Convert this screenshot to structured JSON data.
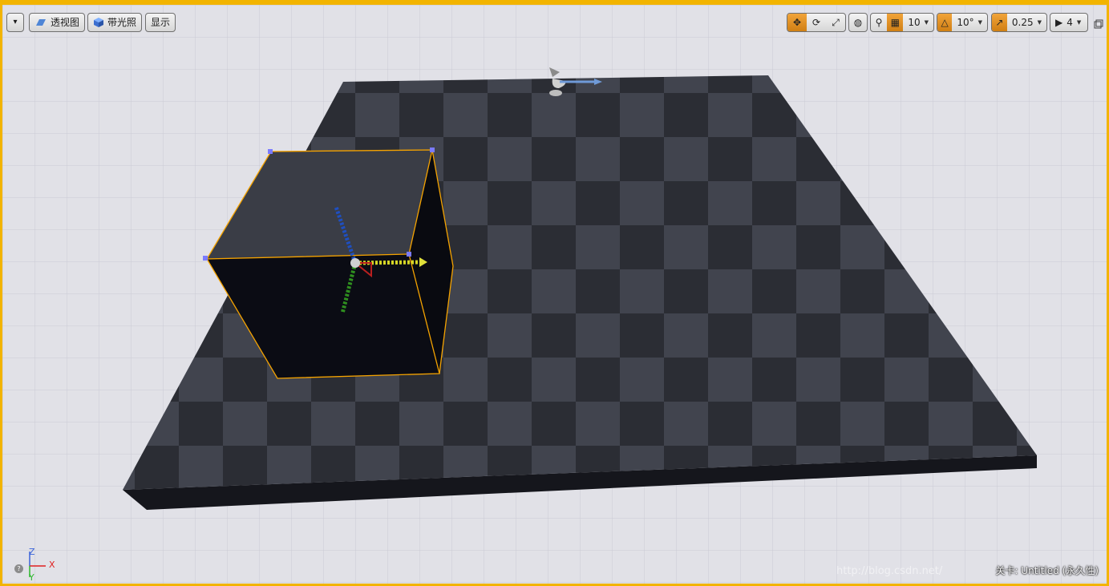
{
  "toolbar": {
    "menu_caret": "▾",
    "perspective_label": "透视图",
    "lit_label": "带光照",
    "show_label": "显示",
    "grid_snap_value": "10",
    "rotation_snap_value": "10°",
    "scale_snap_value": "0.25",
    "camera_speed_value": "4"
  },
  "axes": {
    "z": "Z",
    "x": "X",
    "y": "Y"
  },
  "help_glyph": "?",
  "watermark": "http://blog.csdn.net/",
  "status": {
    "level_label": "关卡: Untitled (永久性)"
  },
  "colors": {
    "accent": "#f2b400",
    "selection": "#f5a300",
    "floor": "#3a3c45",
    "grid": "#cfcfd8"
  }
}
